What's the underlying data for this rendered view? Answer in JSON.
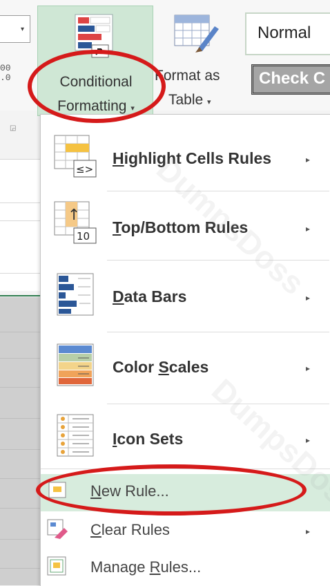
{
  "ribbon": {
    "conditional_formatting": {
      "line1": "Conditional",
      "line2": "Formatting"
    },
    "format_as_table": {
      "line1": "Format as",
      "line2": "Table"
    },
    "styles": {
      "normal": "Normal",
      "check_cell": "Check C"
    },
    "caret": "▾"
  },
  "menu": {
    "items": [
      {
        "pre": "",
        "key": "H",
        "post": "ighlight Cells Rules",
        "arrow": "▸"
      },
      {
        "pre": "",
        "key": "T",
        "post": "op/Bottom Rules",
        "arrow": "▸"
      },
      {
        "pre": "",
        "key": "D",
        "post": "ata Bars",
        "arrow": "▸"
      },
      {
        "pre": "Color ",
        "key": "S",
        "post": "cales",
        "arrow": "▸"
      },
      {
        "pre": "",
        "key": "I",
        "post": "con Sets",
        "arrow": "▸"
      },
      {
        "pre": "",
        "key": "N",
        "post": "ew Rule...",
        "arrow": ""
      },
      {
        "pre": "",
        "key": "C",
        "post": "lear Rules",
        "arrow": "▸"
      },
      {
        "pre": "Manage ",
        "key": "R",
        "post": "ules...",
        "arrow": ""
      }
    ],
    "icon_texts": {
      "highlight": "≤>",
      "topbottom": "10",
      "topbottom_arrow": "↑"
    }
  },
  "colors": {
    "accent_green": "#cfe7d5",
    "annotation_red": "#d51a1a",
    "hover_green": "#d7ecdd"
  },
  "watermark": "DumpsDoss"
}
